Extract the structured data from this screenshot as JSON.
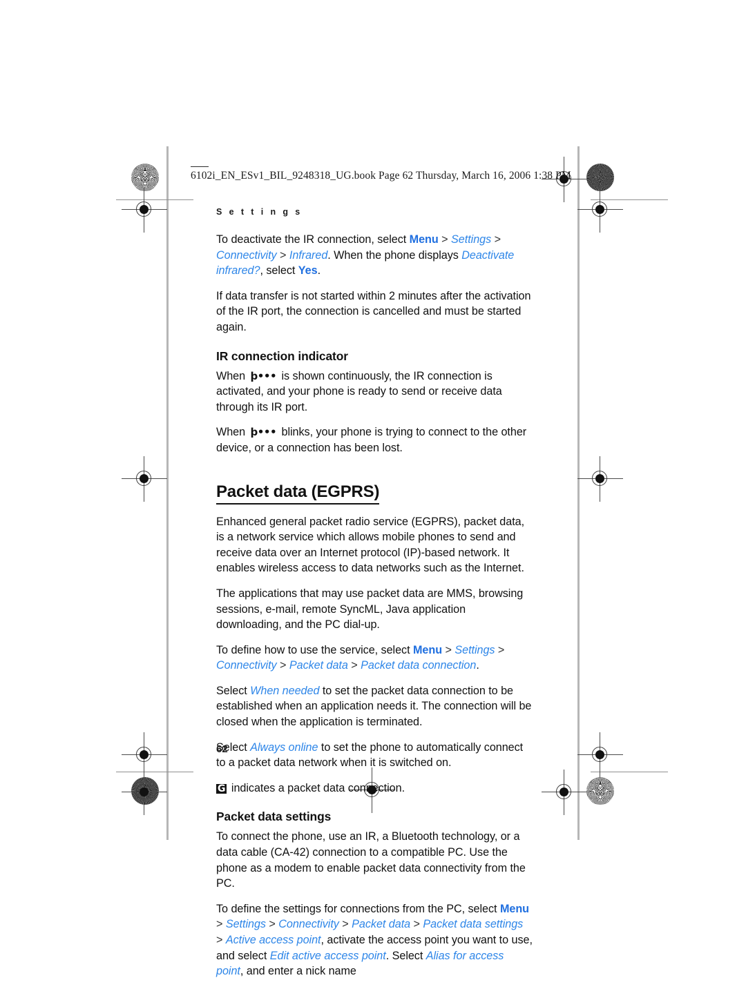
{
  "print_header": {
    "text": "6102i_EN_ESv1_BIL_9248318_UG.book  Page 62  Thursday, March 16, 2006  1:38 PM"
  },
  "running_head": "S e t t i n g s",
  "page_number": "62",
  "colors": {
    "link_blue": "#1f6fe0",
    "param_blue": "#2e86e8",
    "text_black": "#111111",
    "rule_gray": "#b6b6b6"
  },
  "icons": {
    "ir_indicator": "þ•••",
    "gprs_indicator": "G"
  },
  "body": {
    "p1": {
      "t1": "To deactivate the IR connection, select ",
      "link1": "Menu",
      "s1": " > ",
      "param1": "Settings",
      "s2": " > ",
      "param2": "Connectivity",
      "s3": " > ",
      "param3": "Infrared",
      "t2": ". When the phone displays ",
      "param4": "Deactivate infrared?",
      "t3": ", select ",
      "link2": "Yes",
      "t4": "."
    },
    "p2": "If data transfer is not started within 2 minutes after the activation of the IR port, the connection is cancelled and must be started again.",
    "h_ir": "IR connection indicator",
    "p3": {
      "t1": "When ",
      "t2": " is shown continuously, the IR connection is activated, and your phone is ready to send or receive data through its IR port."
    },
    "p4": {
      "t1": "When ",
      "t2": " blinks, your phone is trying to connect to the other device, or a connection has been lost."
    },
    "h_packet": "Packet data (EGPRS)",
    "p5": "Enhanced general packet radio service (EGPRS), packet data, is a network service which allows mobile phones to send and receive data over an Internet protocol (IP)-based network. It enables wireless access to data networks such as the Internet.",
    "p6": "The applications that may use packet data are MMS, browsing sessions, e-mail, remote SyncML, Java application downloading, and the PC dial-up.",
    "p7": {
      "t1": "To define how to use the service, select ",
      "link1": "Menu",
      "s1": " > ",
      "param1": "Settings",
      "s2": " > ",
      "param2": "Connectivity",
      "s3": " > ",
      "param3": "Packet data",
      "s4": " > ",
      "param4": "Packet data connection",
      "t2": "."
    },
    "p8": {
      "t1": "Select ",
      "param1": "When needed",
      "t2": " to set the packet data connection to be established when an application needs it. The connection will be closed when the application is terminated."
    },
    "p9": {
      "t1": "Select ",
      "param1": "Always online",
      "t2": " to set the phone to automatically connect to a packet data network when it is switched on."
    },
    "p10": {
      "t1": " indicates a packet data connection."
    },
    "h_settings": "Packet data settings",
    "p11": "To connect the phone, use an IR, a Bluetooth technology, or a data cable (CA-42) connection to a compatible PC. Use the phone as a modem to enable packet data connectivity from the PC.",
    "p12": {
      "t1": "To define the settings for connections from the PC, select ",
      "link1": "Menu",
      "s1": " > ",
      "param1": "Settings",
      "s2": " > ",
      "param2": "Connectivity",
      "s3": " > ",
      "param3": "Packet data",
      "s4": " > ",
      "param4": "Packet data settings",
      "s5": " > ",
      "param5": "Active access point",
      "t2": ", activate the access point you want to use, and select ",
      "param6": "Edit active access point",
      "t3": ". Select ",
      "param7": "Alias for access point",
      "t4": ", and enter a nick name"
    }
  }
}
